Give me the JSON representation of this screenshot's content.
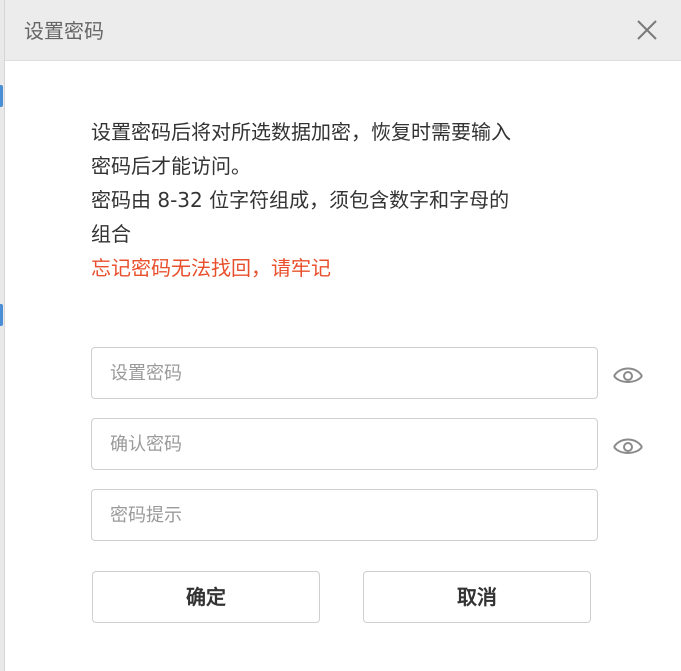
{
  "dialog": {
    "title": "设置密码",
    "close_icon": "close-icon"
  },
  "description": {
    "line1": "设置密码后将对所选数据加密，恢复时需要输入",
    "line2": "密码后才能访问。",
    "line3": "密码由 8-32 位字符组成，须包含数字和字母的",
    "line4": "组合",
    "warning": "忘记密码无法找回，请牢记",
    "warning_color": "#e8502d"
  },
  "fields": {
    "password": {
      "placeholder": "设置密码",
      "value": "",
      "toggle_icon": "eye-icon"
    },
    "confirm": {
      "placeholder": "确认密码",
      "value": "",
      "toggle_icon": "eye-icon"
    },
    "hint": {
      "placeholder": "密码提示",
      "value": ""
    }
  },
  "buttons": {
    "ok_label": "确定",
    "cancel_label": "取消"
  }
}
